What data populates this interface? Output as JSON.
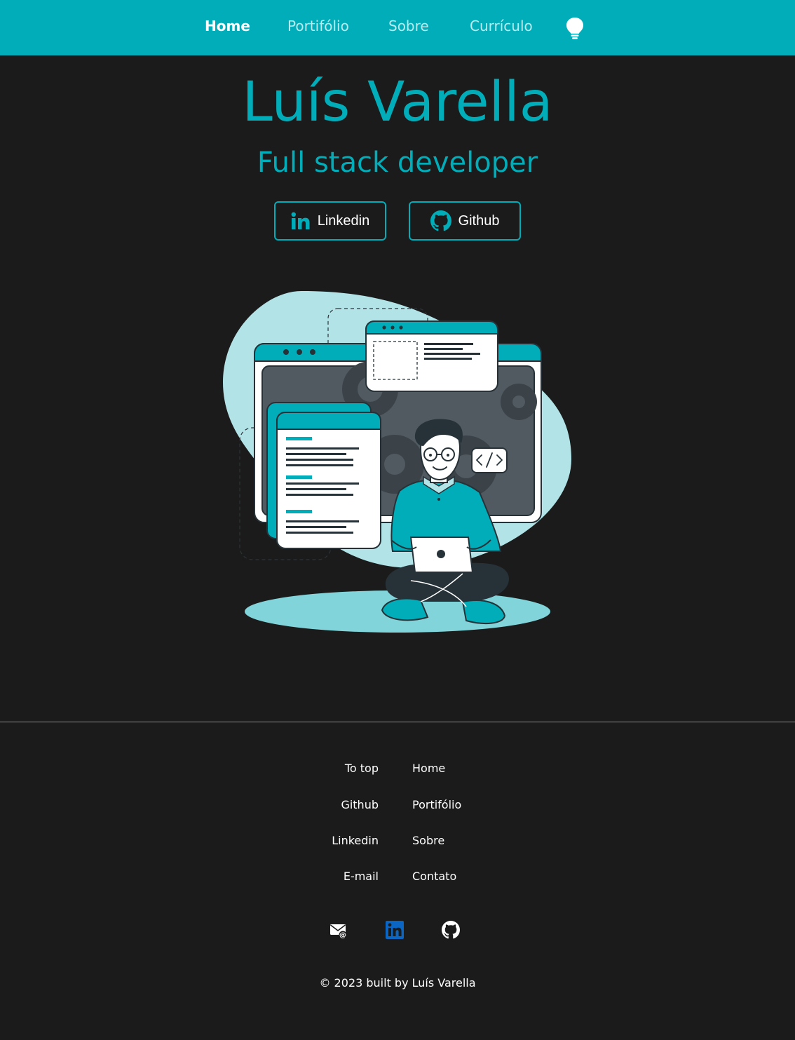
{
  "nav": {
    "items": [
      {
        "label": "Home",
        "active": true
      },
      {
        "label": "Portifólio",
        "active": false
      },
      {
        "label": "Sobre",
        "active": false
      },
      {
        "label": "Currículo",
        "active": false
      }
    ],
    "theme_icon": "lightbulb-icon"
  },
  "hero": {
    "name": "Luís Varella",
    "role": "Full stack developer",
    "buttons": [
      {
        "label": "Linkedin",
        "icon": "linkedin-icon"
      },
      {
        "label": "Github",
        "icon": "github-icon"
      }
    ],
    "illustration": "developer-with-laptop-illustration"
  },
  "footer": {
    "left_links": [
      "To top",
      "Github",
      "Linkedin",
      "E-mail"
    ],
    "right_links": [
      "Home",
      "Portifólio",
      "Sobre",
      "Contato"
    ],
    "icons": [
      "email-icon",
      "linkedin-icon",
      "github-icon"
    ],
    "copyright": "© 2023 built by Luís Varella"
  },
  "colors": {
    "accent": "#00adb9",
    "background": "#1b1b1b",
    "nav_inactive": "#b8eaee",
    "linkedin_blue": "#0a66c2"
  }
}
